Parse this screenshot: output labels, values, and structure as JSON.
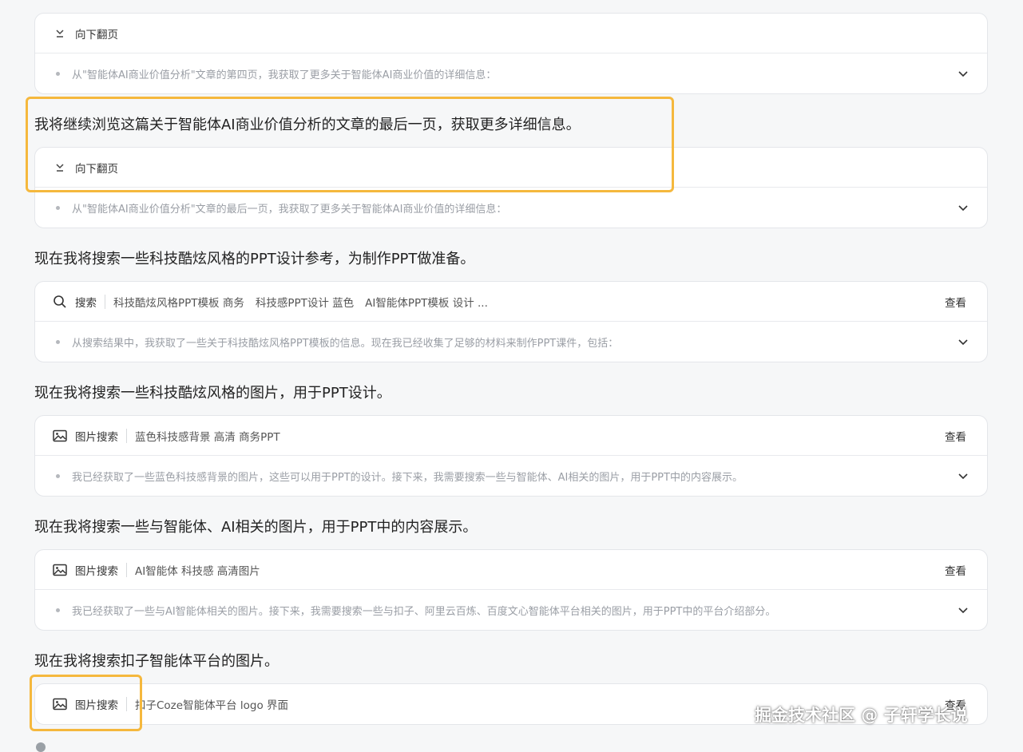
{
  "cards": [
    {
      "tool": "向下翻页",
      "icon": "chevrons-down-icon",
      "query": "",
      "view": "",
      "summary": "从\"智能体AI商业价值分析\"文章的第四页，我获取了更多关于智能体AI商业价值的详细信息："
    },
    {
      "tool": "向下翻页",
      "icon": "chevrons-down-icon",
      "query": "",
      "view": "",
      "summary": "从\"智能体AI商业价值分析\"文章的最后一页，我获取了更多关于智能体AI商业价值的详细信息："
    },
    {
      "tool": "搜索",
      "icon": "search-icon",
      "queries": [
        "科技酷炫风格PPT模板 商务",
        "科技感PPT设计 蓝色",
        "AI智能体PPT模板 设计 ..."
      ],
      "view": "查看",
      "summary": "从搜索结果中，我获取了一些关于科技酷炫风格PPT模板的信息。现在我已经收集了足够的材料来制作PPT课件，包括："
    },
    {
      "tool": "图片搜索",
      "icon": "image-icon",
      "query": "蓝色科技感背景 高清 商务PPT",
      "view": "查看",
      "summary": "我已经获取了一些蓝色科技感背景的图片，这些可以用于PPT的设计。接下来，我需要搜索一些与智能体、AI相关的图片，用于PPT中的内容展示。"
    },
    {
      "tool": "图片搜索",
      "icon": "image-icon",
      "query": "AI智能体 科技感 高清图片",
      "view": "查看",
      "summary": "我已经获取了一些与AI智能体相关的图片。接下来，我需要搜索一些与扣子、阿里云百炼、百度文心智能体平台相关的图片，用于PPT中的平台介绍部分。"
    },
    {
      "tool": "图片搜索",
      "icon": "image-icon",
      "query": "扣子Coze智能体平台 logo 界面",
      "view": "查看",
      "summary": ""
    }
  ],
  "messages": [
    "我将继续浏览这篇关于智能体AI商业价值分析的文章的最后一页，获取更多详细信息。",
    "现在我将搜索一些科技酷炫风格的PPT设计参考，为制作PPT做准备。",
    "现在我将搜索一些科技酷炫风格的图片，用于PPT设计。",
    "现在我将搜索一些与智能体、AI相关的图片，用于PPT中的内容展示。",
    "现在我将搜索扣子智能体平台的图片。"
  ],
  "watermark": "掘金技术社区 @ 子轩学长说",
  "colors": {
    "highlight": "#f5b83d",
    "background": "#f6f7f8"
  }
}
